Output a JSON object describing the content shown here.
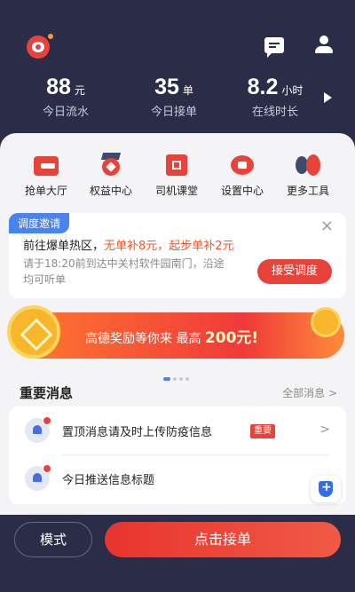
{
  "header": {
    "stats": [
      {
        "value": "88",
        "unit": "元",
        "label": "今日流水"
      },
      {
        "value": "35",
        "unit": "单",
        "label": "今日接单"
      },
      {
        "value": "8.2",
        "unit": "小时",
        "label": "在线时长"
      }
    ]
  },
  "quick_actions": [
    {
      "label": "抢单大厅",
      "icon": "order-hall-icon"
    },
    {
      "label": "权益中心",
      "icon": "medal-icon"
    },
    {
      "label": "司机课堂",
      "icon": "book-icon"
    },
    {
      "label": "设置中心",
      "icon": "settings-icon"
    },
    {
      "label": "更多工具",
      "icon": "tools-icon"
    }
  ],
  "invite": {
    "tag": "调度邀请",
    "close": "×",
    "title_prefix": "前往爆单热区，",
    "title_highlight": "无单补8元，起步单补2元",
    "desc": "请于18:20前到达中关村软件园南门，沿途均可听单",
    "button": "接受调度"
  },
  "banner": {
    "text": "高德奖励等你来 最高",
    "amount": "200元!"
  },
  "news": {
    "heading": "重要消息",
    "all_link": "全部消息 >",
    "items": [
      {
        "text": "置顶消息请及时上传防疫信息",
        "badge": "重要"
      },
      {
        "text": "今日推送信息标题"
      }
    ]
  },
  "footer": {
    "mode_label": "模式",
    "accept_label": "点击接单"
  },
  "colors": {
    "accent": "#e8433a",
    "dark_bg": "#2b2c47",
    "blue": "#4a82f0"
  }
}
